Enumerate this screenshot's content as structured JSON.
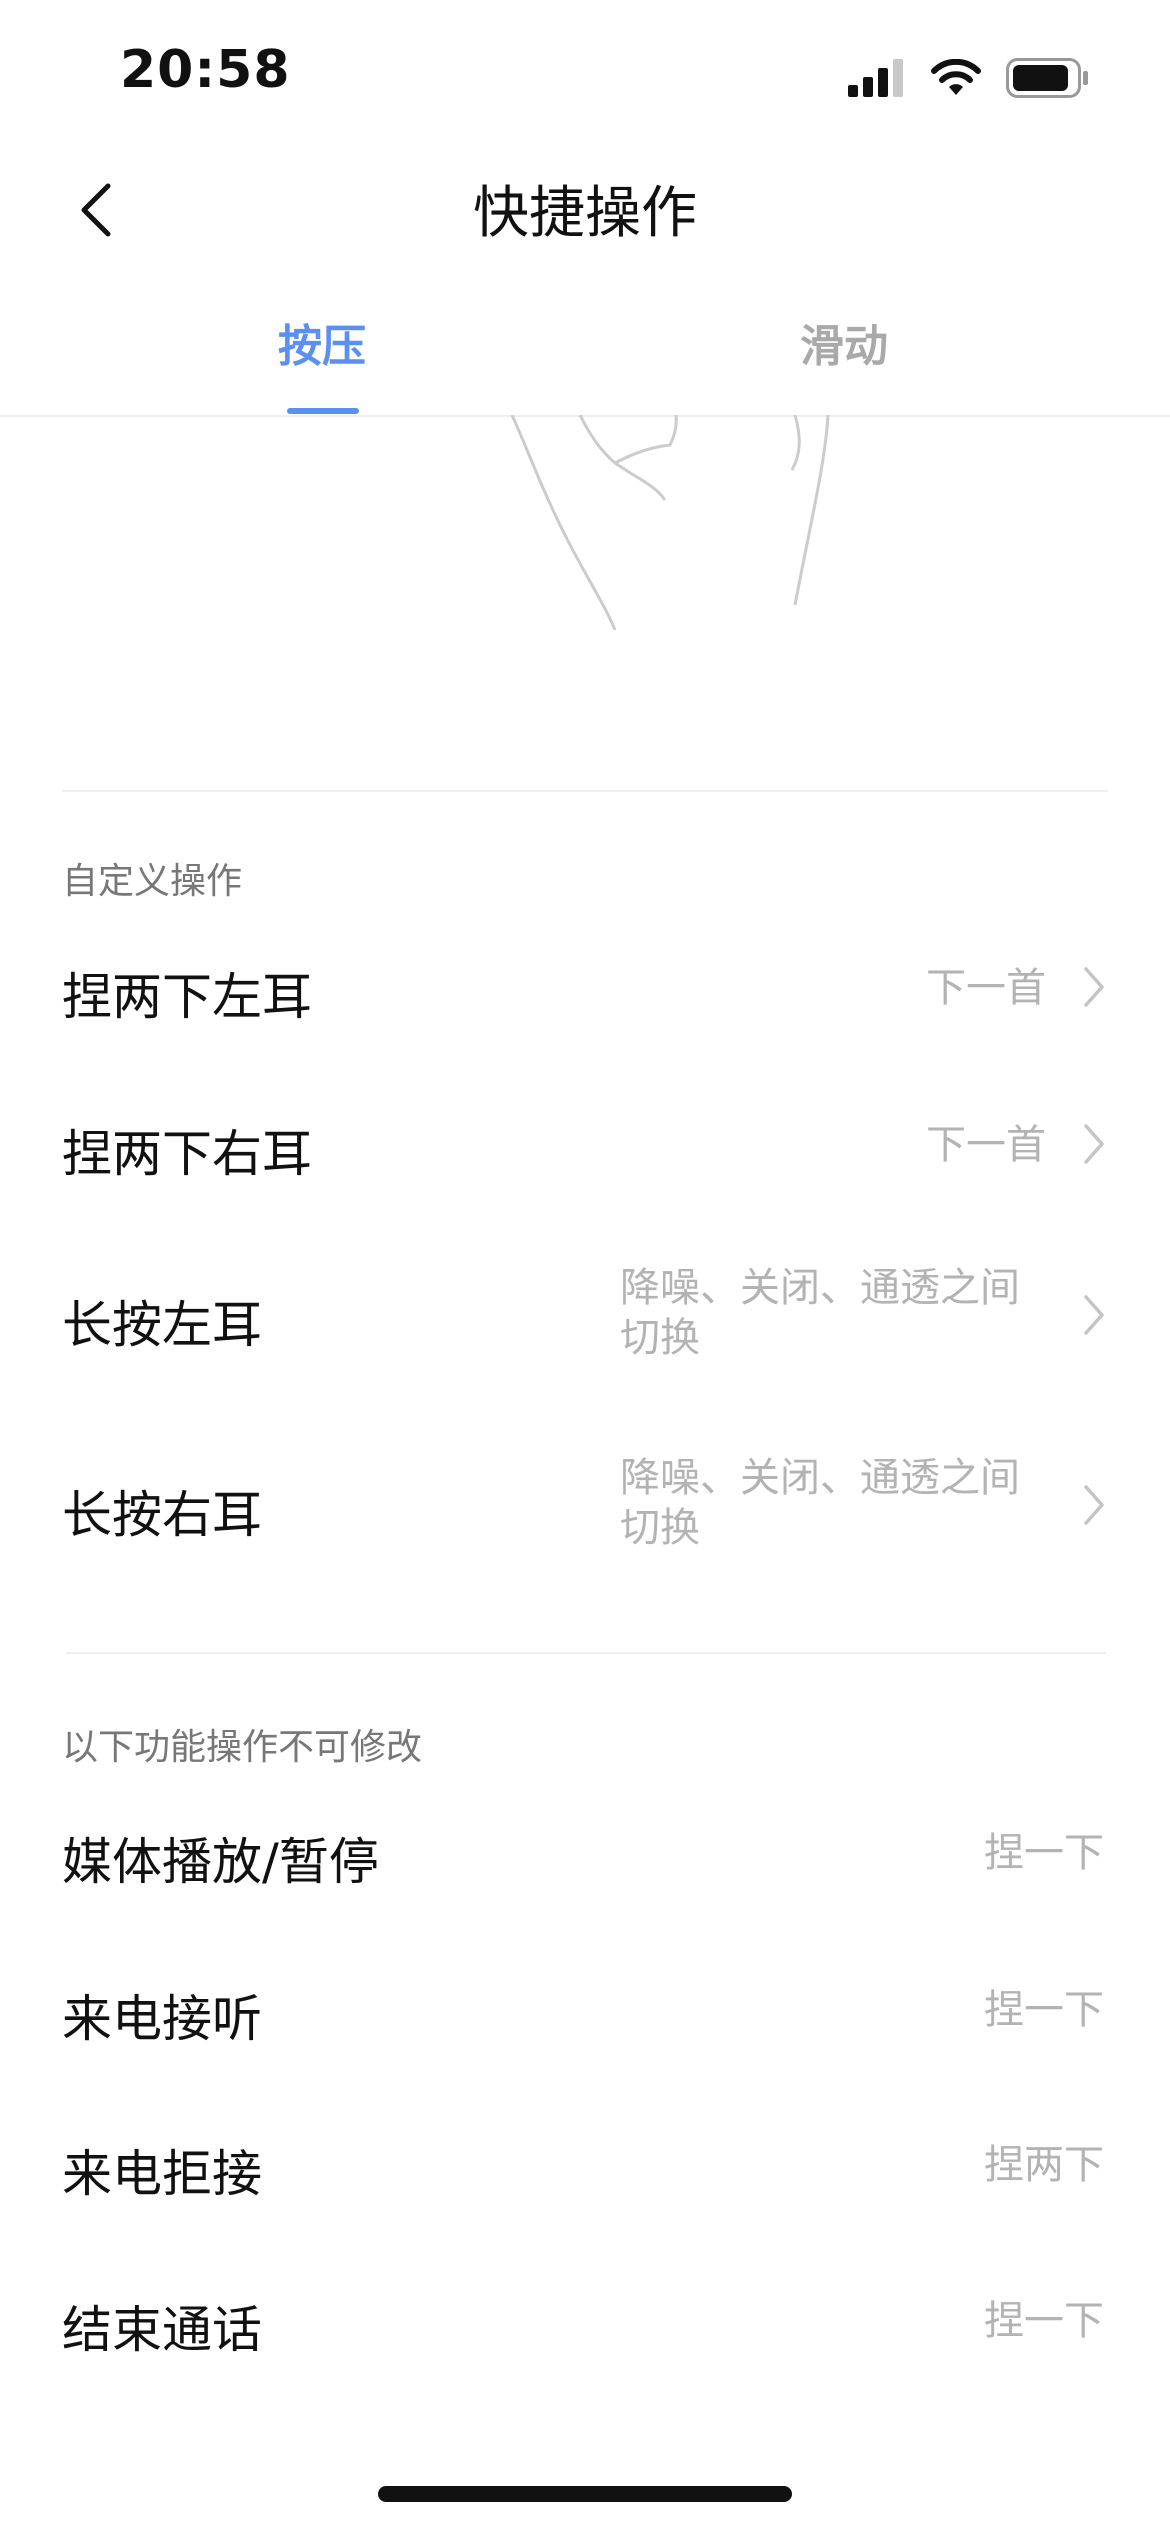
{
  "status_bar": {
    "time": "20:58",
    "icons": [
      "cellular-signal-icon",
      "wifi-icon",
      "battery-icon"
    ]
  },
  "header": {
    "title": "快捷操作",
    "back_icon": "chevron-left-icon"
  },
  "tabs": [
    {
      "label": "按压",
      "active": true
    },
    {
      "label": "滑动",
      "active": false
    }
  ],
  "colors": {
    "accent": "#5B8FF0",
    "muted": "#b3b3b3",
    "section_label": "#777777"
  },
  "custom_section": {
    "label": "自定义操作",
    "items": [
      {
        "label": "捏两下左耳",
        "value": "下一首"
      },
      {
        "label": "捏两下右耳",
        "value": "下一首"
      },
      {
        "label": "长按左耳",
        "value": "降噪、关闭、通透之间切换"
      },
      {
        "label": "长按右耳",
        "value": "降噪、关闭、通透之间切换"
      }
    ]
  },
  "fixed_section": {
    "label": "以下功能操作不可修改",
    "items": [
      {
        "label": "媒体播放/暂停",
        "value": "捏一下"
      },
      {
        "label": "来电接听",
        "value": "捏一下"
      },
      {
        "label": "来电拒接",
        "value": "捏两下"
      },
      {
        "label": "结束通话",
        "value": "捏一下"
      }
    ]
  }
}
